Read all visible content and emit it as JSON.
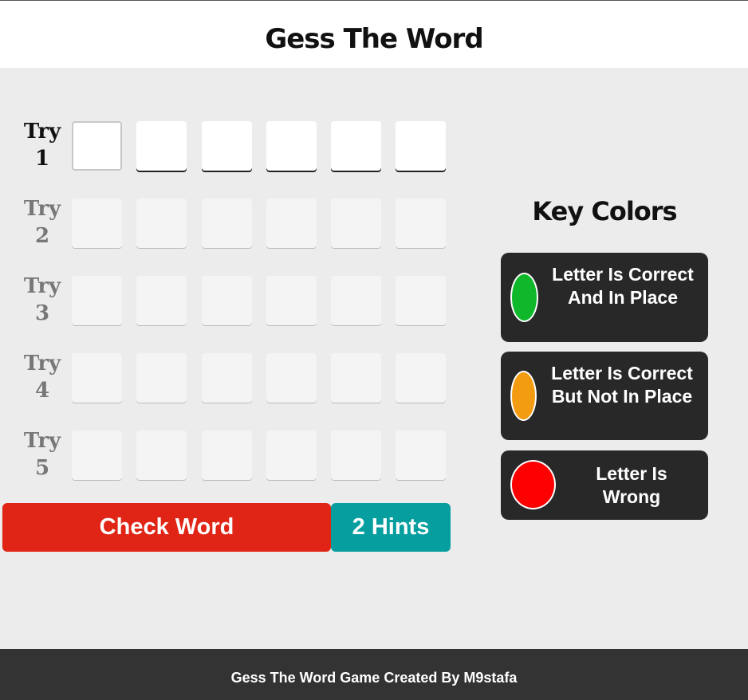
{
  "header": {
    "title": "Gess The Word"
  },
  "board": {
    "tries": [
      {
        "label": "Try",
        "number": "1"
      },
      {
        "label": "Try",
        "number": "2"
      },
      {
        "label": "Try",
        "number": "3"
      },
      {
        "label": "Try",
        "number": "4"
      },
      {
        "label": "Try",
        "number": "5"
      }
    ],
    "letters_per_word": 6,
    "active_try": 1
  },
  "controls": {
    "check_label": "Check Word",
    "hints_count": "2",
    "hints_label": "Hints"
  },
  "key_colors": {
    "title": "Key Colors",
    "items": [
      {
        "text": "Letter Is Correct And In Place",
        "color": "#0eb82a"
      },
      {
        "text": "Letter Is Correct But Not In Place",
        "color": "#f39c12"
      },
      {
        "text": "Letter Is Wrong",
        "color": "#ff0000"
      }
    ]
  },
  "footer": {
    "text": "Gess The Word Game Created By M9stafa"
  }
}
